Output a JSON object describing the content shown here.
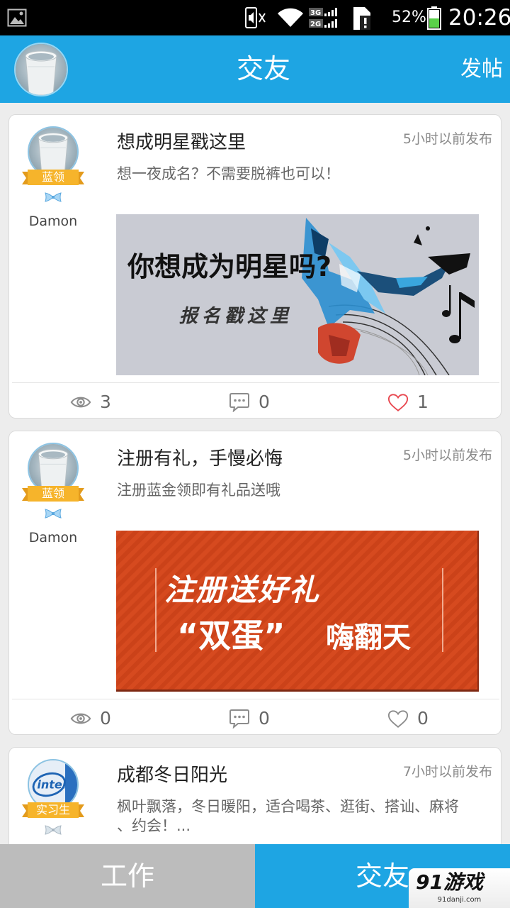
{
  "status_bar": {
    "network_3g": "3G",
    "network_2g": "2G",
    "battery_text": "52%",
    "battery_level": 0.52,
    "time": "20:26",
    "icons": [
      "gallery-icon",
      "mute-icon",
      "wifi-icon",
      "signal-icon",
      "sim-alert-icon",
      "battery-icon"
    ]
  },
  "header": {
    "title": "交友",
    "post_button": "发帖",
    "avatar_icon": "user-avatar"
  },
  "posts": [
    {
      "author": "Damon",
      "badge": "蓝领",
      "title": "想成明星戳这里",
      "time": "5小时以前发布",
      "summary": "想一夜成名？不需要脱裤也可以！",
      "banner": {
        "line1": "你想成为明星吗?",
        "line2": "报名戳这里"
      },
      "views": "3",
      "comments": "0",
      "likes": "1",
      "liked": true
    },
    {
      "author": "Damon",
      "badge": "蓝领",
      "title": "注册有礼，手慢必悔",
      "time": "5小时以前发布",
      "summary": "注册蓝金领即有礼品送哦",
      "banner": {
        "line1": "注册送好礼",
        "line2": "“双蛋”",
        "line3": "嗨翻天"
      },
      "views": "0",
      "comments": "0",
      "likes": "0",
      "liked": false
    },
    {
      "badge": "实习生",
      "avatar_logo": "intel",
      "title": "成都冬日阳光",
      "time": "7小时以前发布",
      "summary": "枫叶飘落，冬日暖阳，适合喝茶、逛街、搭讪、麻将、约会！..."
    }
  ],
  "footer_icons": [
    "eye-icon",
    "comment-icon",
    "heart-icon"
  ],
  "bottom_nav": {
    "tabs": [
      {
        "label": "工作",
        "active": false
      },
      {
        "label": "交友",
        "active": true
      }
    ]
  },
  "watermark": {
    "logo": "91游戏",
    "site": "91danji.com"
  },
  "colors": {
    "primary": "#1ea5e3",
    "tab_inactive": "#bcbcbc",
    "like_active": "#e8474f",
    "icon_gray": "#8c8c8c",
    "badge": "#f6b42b"
  }
}
